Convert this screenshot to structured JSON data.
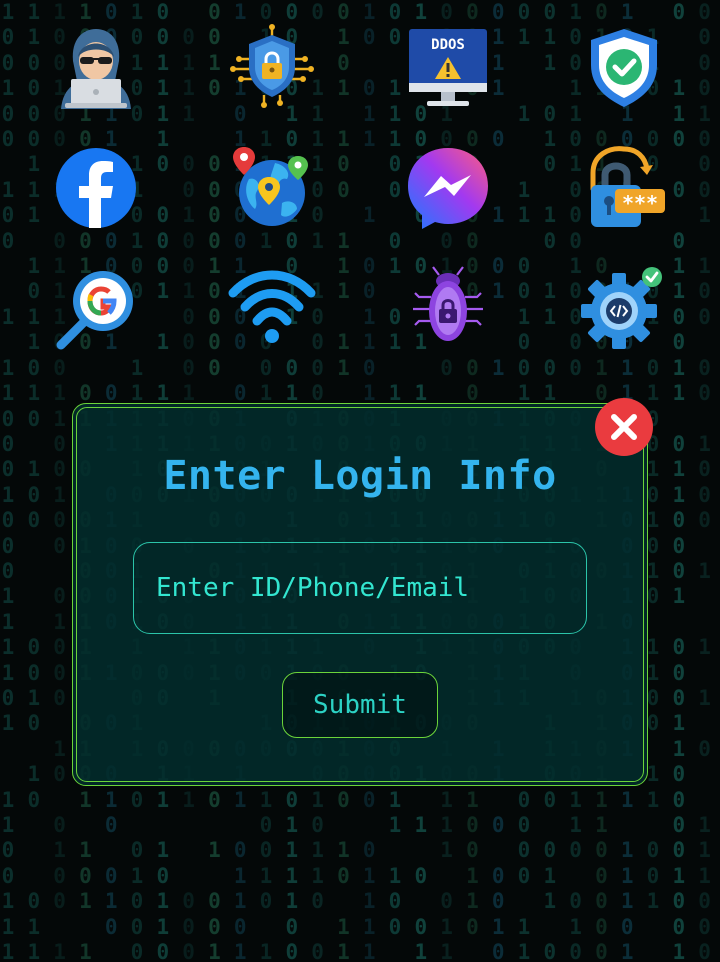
{
  "background": {
    "digits": "0110100101101001101001011001011010010110",
    "colors": [
      "#0e3a36",
      "#11453f",
      "#0c2f2c",
      "#153f2f",
      "#0d3340"
    ]
  },
  "icons": [
    {
      "name": "hacker-icon"
    },
    {
      "name": "cyber-security-chip-icon"
    },
    {
      "name": "ddos-monitor-icon",
      "label": "DDOS"
    },
    {
      "name": "shield-check-icon"
    },
    {
      "name": "facebook-icon"
    },
    {
      "name": "globe-location-pins-icon"
    },
    {
      "name": "messenger-icon"
    },
    {
      "name": "password-lock-icon",
      "label": "***"
    },
    {
      "name": "google-search-icon"
    },
    {
      "name": "wifi-icon"
    },
    {
      "name": "bug-lock-icon"
    },
    {
      "name": "code-gear-check-icon"
    }
  ],
  "login": {
    "title": "Enter Login Info",
    "placeholder": "Enter ID/Phone/Email",
    "value": "",
    "submit_label": "Submit"
  },
  "colors": {
    "accent_title": "#34b4ee",
    "border_green": "#6bd43a",
    "input_border": "#2bc4a9",
    "input_text": "#33e6d0",
    "close_red": "#ea3b3f"
  }
}
